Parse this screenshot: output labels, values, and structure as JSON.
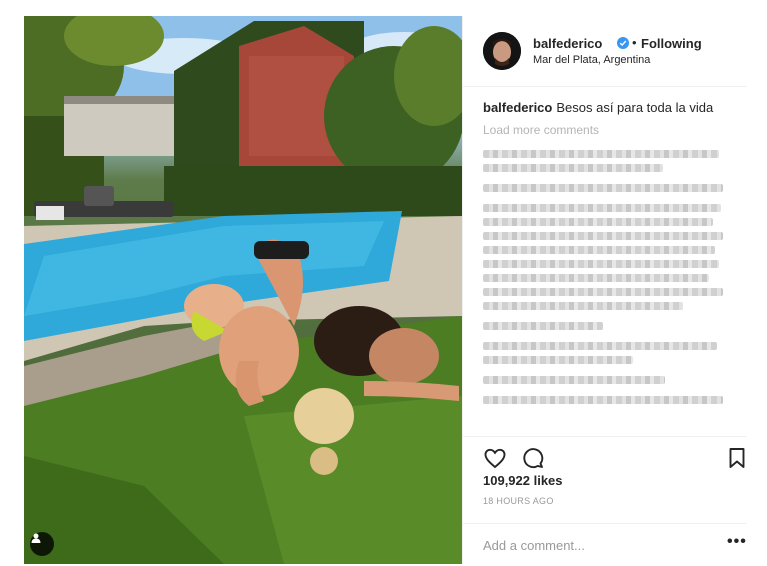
{
  "post": {
    "username": "balfederico",
    "follow_label": "Following",
    "separator": "•",
    "location": "Mar del Plata, Argentina",
    "caption_user": "balfederico",
    "caption_text": "Besos así para toda la vida",
    "load_more": "Load more comments",
    "likes": "109,922 likes",
    "time": "18 HOURS AGO",
    "comment_placeholder": "Add a comment...",
    "more_label": "•••"
  },
  "icons": {
    "verified": "verified-badge-icon",
    "like": "heart-icon",
    "comment": "comment-bubble-icon",
    "save": "bookmark-icon",
    "tag": "user-tag-icon"
  },
  "colors": {
    "verified": "#3897f0",
    "text": "#262626",
    "muted": "#999999",
    "divider": "#efefef",
    "pool": "#29a8d8",
    "grass": "#4b7a22"
  }
}
